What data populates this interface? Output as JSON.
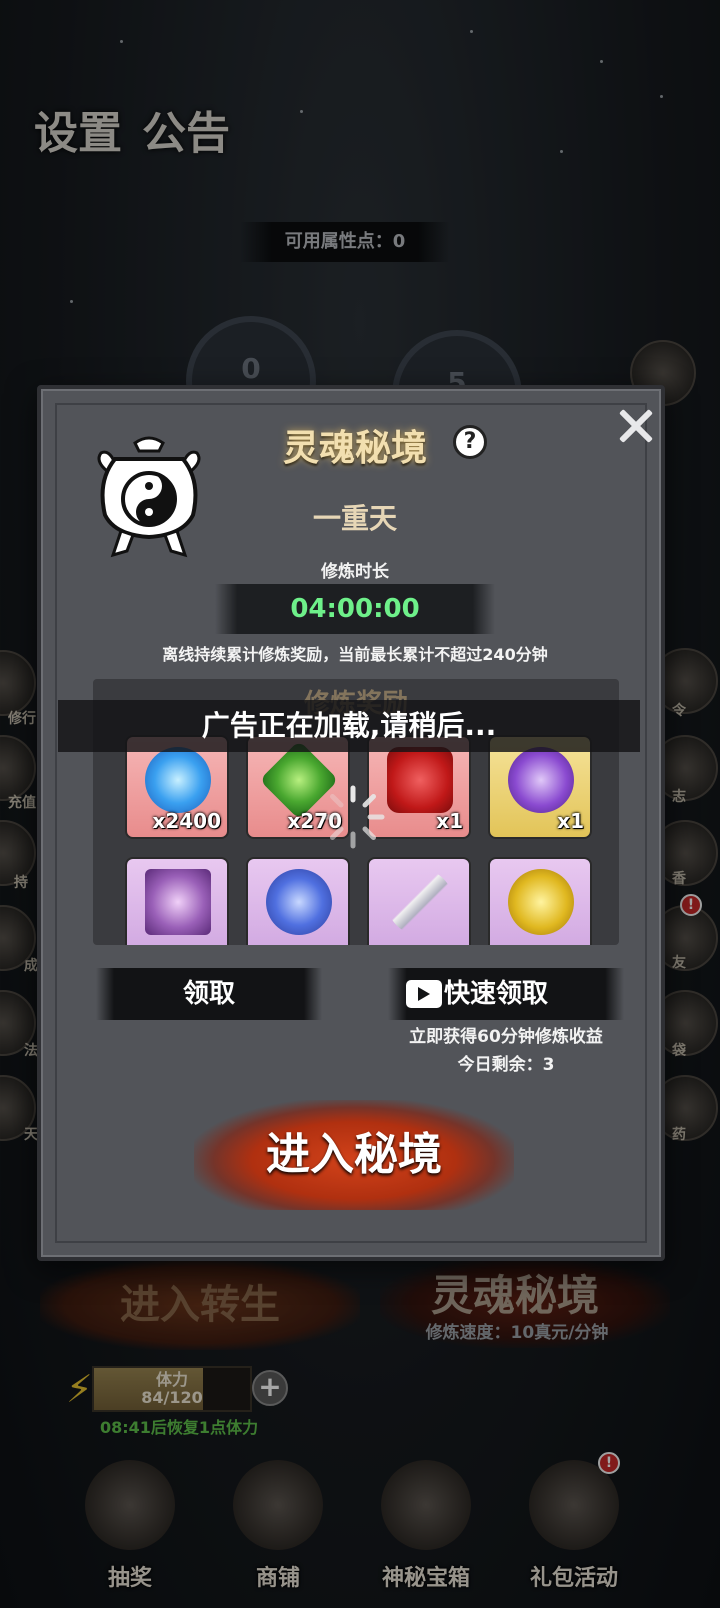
{
  "background": {
    "settings_label": "设置",
    "notice_label": "公告",
    "attribute_points": "可用属性点：0",
    "circle_left_value": "0",
    "circle_right_value": "5",
    "side_labels_left": [
      "修行",
      "充值",
      "持",
      "成",
      "法",
      "天"
    ],
    "side_labels_right": [
      "令",
      "志",
      "香",
      "友",
      "袋",
      "药"
    ],
    "rebirth_button": "进入转生",
    "soul_realm_button": "灵魂秘境",
    "cultivation_speed": "修炼速度：10真元/分钟",
    "stamina_label": "体力",
    "stamina_value": "84/120",
    "stamina_fraction": 0.7,
    "stamina_regen": "08:41后恢复1点体力",
    "nav": [
      {
        "label": "抽奖"
      },
      {
        "label": "商铺"
      },
      {
        "label": "神秘宝箱"
      },
      {
        "label": "礼包活动"
      }
    ],
    "badge": "!"
  },
  "dialog": {
    "title": "灵魂秘境",
    "help": "?",
    "realm_name": "一重天",
    "time_label": "修炼时长",
    "timer": "04:00:00",
    "description": "离线持续累计修炼奖励，当前最长累计不超过240分钟",
    "reward_title": "修炼奖励",
    "rewards": [
      {
        "qty": "x2400",
        "bg": "red",
        "art": "blue-flame-orb-icon"
      },
      {
        "qty": "x270",
        "bg": "red",
        "art": "green-jade-pendant-icon"
      },
      {
        "qty": "x1",
        "bg": "red",
        "art": "red-puzzle-piece-icon"
      },
      {
        "qty": "x1",
        "bg": "gold",
        "art": "purple-golden-axe-icon"
      },
      {
        "qty": "",
        "bg": "purple",
        "art": "spellbook-orb-icon"
      },
      {
        "qty": "",
        "bg": "purple",
        "art": "sapphire-ring-icon"
      },
      {
        "qty": "",
        "bg": "purple",
        "art": "sword-icon"
      },
      {
        "qty": "",
        "bg": "purple",
        "art": "golden-necklace-icon"
      }
    ],
    "claim_button": "领取",
    "fast_claim_button": "快速领取",
    "fast_claim_desc": "立即获得60分钟修炼收益",
    "fast_claim_remaining": "今日剩余：3",
    "enter_button": "进入秘境"
  },
  "toast": "广告正在加载,请稍后..."
}
